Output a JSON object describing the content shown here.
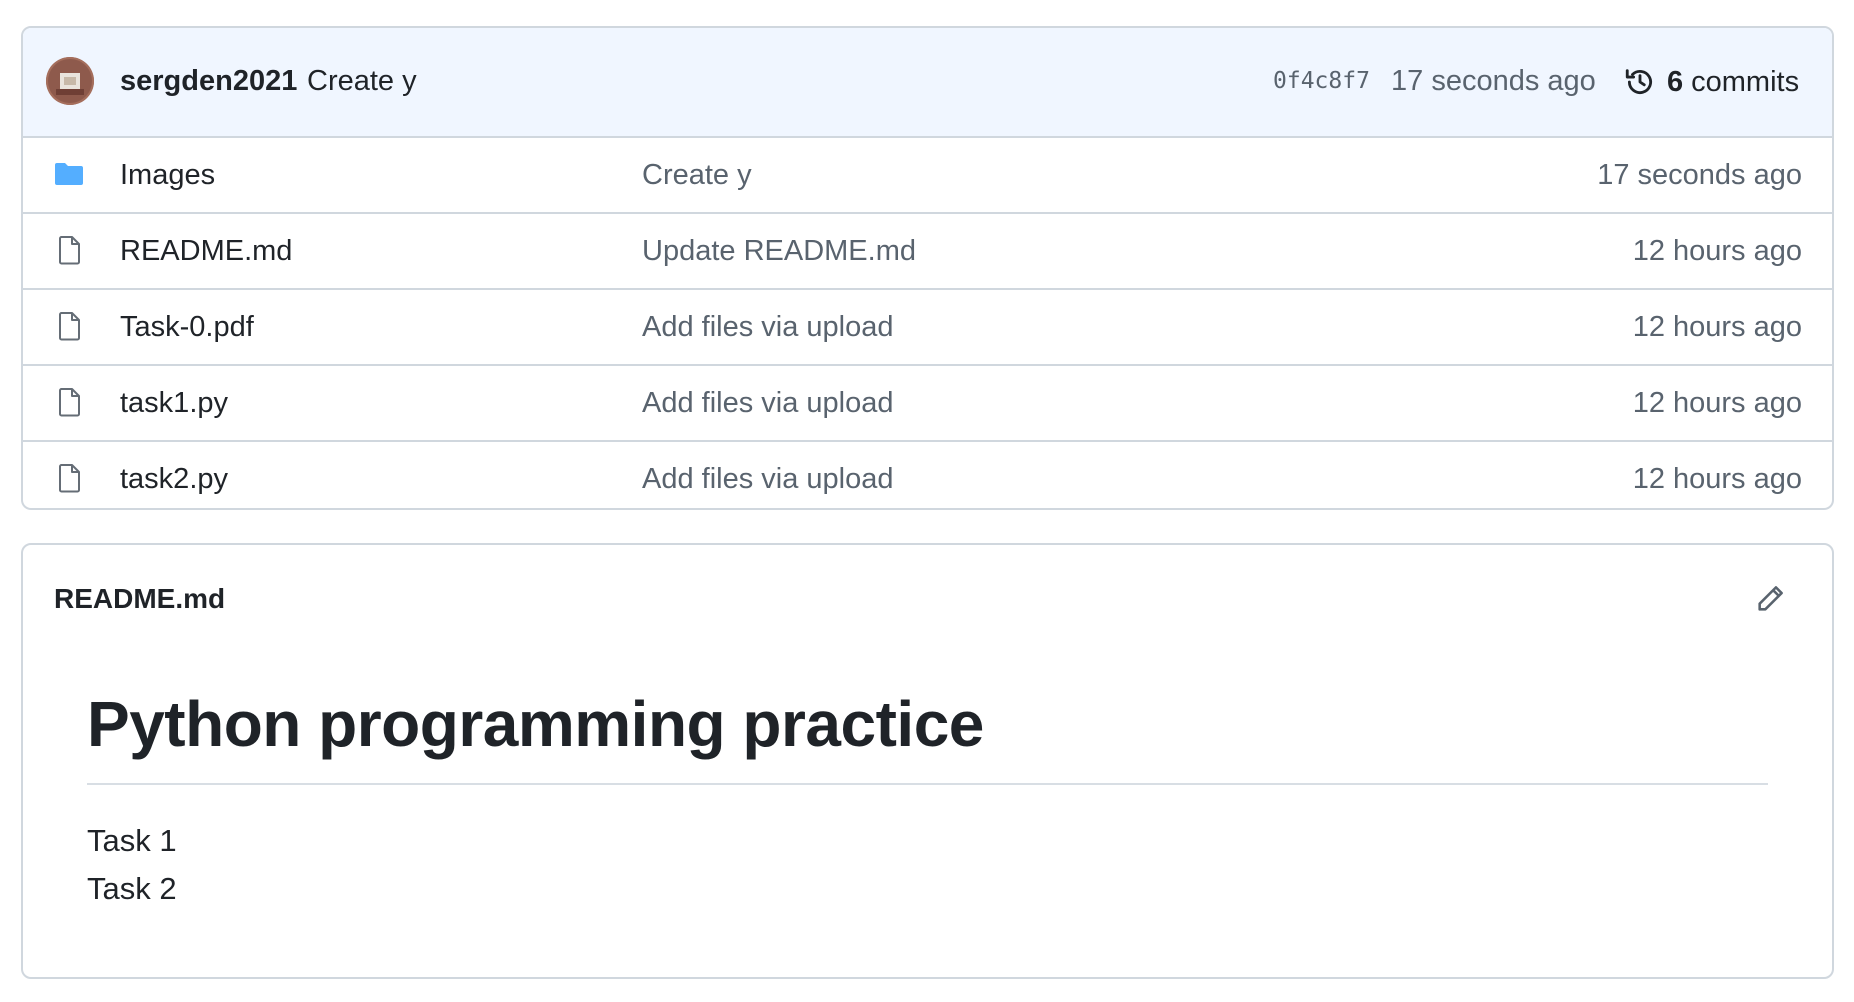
{
  "latest_commit": {
    "author": "sergden2021",
    "message": "Create y",
    "sha": "0f4c8f7",
    "time": "17 seconds ago",
    "commit_count": "6",
    "commit_count_label": "commits"
  },
  "files": [
    {
      "name": "Images",
      "type": "folder",
      "icon": "folder-icon",
      "message": "Create y",
      "time": "17 seconds ago"
    },
    {
      "name": "README.md",
      "type": "file",
      "icon": "file-icon",
      "message": "Update README.md",
      "time": "12 hours ago"
    },
    {
      "name": "Task-0.pdf",
      "type": "file",
      "icon": "file-icon",
      "message": "Add files via upload",
      "time": "12 hours ago"
    },
    {
      "name": "task1.py",
      "type": "file",
      "icon": "file-icon",
      "message": "Add files via upload",
      "time": "12 hours ago"
    },
    {
      "name": "task2.py",
      "type": "file",
      "icon": "file-icon",
      "message": "Add files via upload",
      "time": "12 hours ago"
    }
  ],
  "readme": {
    "filename": "README.md",
    "edit_icon": "pencil-icon",
    "heading": "Python programming practice",
    "lines": [
      "Task 1",
      "Task 2"
    ]
  },
  "colors": {
    "header_bg": "#f0f6ff",
    "border": "#d0d7de",
    "folder": "#54aeff",
    "muted_text": "#59636e",
    "primary_text": "#1f2328"
  }
}
